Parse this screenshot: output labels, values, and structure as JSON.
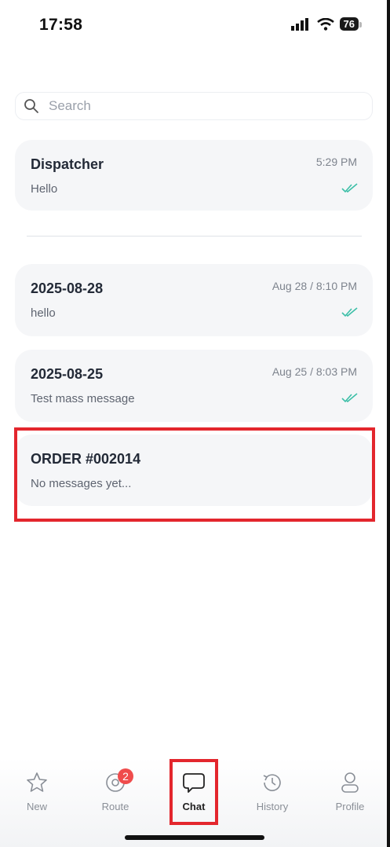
{
  "status_bar": {
    "time": "17:58",
    "battery": "76"
  },
  "search": {
    "placeholder": "Search"
  },
  "conversations": [
    {
      "title": "Dispatcher",
      "time": "5:29 PM",
      "preview": "Hello",
      "read": true
    },
    {
      "title": "2025-08-28",
      "time": "Aug 28 / 8:10 PM",
      "preview": "hello",
      "read": true
    },
    {
      "title": "2025-08-25",
      "time": "Aug 25 / 8:03 PM",
      "preview": "Test mass message",
      "read": true
    },
    {
      "title": "ORDER #002014",
      "time": "",
      "preview": "No messages yet...",
      "read": false
    }
  ],
  "tabs": [
    {
      "label": "New",
      "icon": "star-icon"
    },
    {
      "label": "Route",
      "icon": "route-pin-icon",
      "badge": "2"
    },
    {
      "label": "Chat",
      "icon": "chat-bubble-icon",
      "active": true
    },
    {
      "label": "History",
      "icon": "history-icon"
    },
    {
      "label": "Profile",
      "icon": "profile-icon"
    }
  ],
  "colors": {
    "accent_read": "#3dbfa8",
    "highlight": "#e3262d",
    "badge": "#ef4c4c"
  }
}
